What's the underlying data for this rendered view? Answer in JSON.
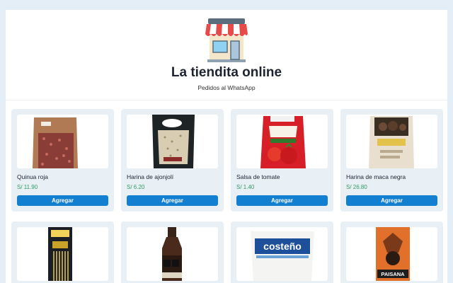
{
  "header": {
    "icon": "store-icon",
    "title": "La tiendita online",
    "subtitle": "Pedidos al WhatsApp"
  },
  "products": [
    {
      "name": "Quinua roja",
      "price": "S/ 11.90",
      "button": "Agregar",
      "image_icon": "quinoa-bag-icon"
    },
    {
      "name": "Harina de ajonjolí",
      "price": "S/ 6.20",
      "button": "Agregar",
      "image_icon": "sesame-flour-bag-icon"
    },
    {
      "name": "Salsa de tomate",
      "price": "S/ 1.40",
      "button": "Agregar",
      "image_icon": "tomato-sauce-pouch-icon"
    },
    {
      "name": "Harina de maca negra",
      "price": "S/ 26.80",
      "button": "Agregar",
      "image_icon": "maca-flour-bag-icon"
    },
    {
      "image_icon": "pasta-package-icon"
    },
    {
      "image_icon": "sauce-bottle-icon"
    },
    {
      "image_icon": "rice-bag-icon",
      "label": "costeño"
    },
    {
      "image_icon": "packaged-product-icon",
      "label": "PAISANA"
    }
  ],
  "colors": {
    "accent": "#137fd1",
    "price": "#2e9e63",
    "card_bg": "#e8eff5",
    "page_bg": "#e4eef7"
  }
}
